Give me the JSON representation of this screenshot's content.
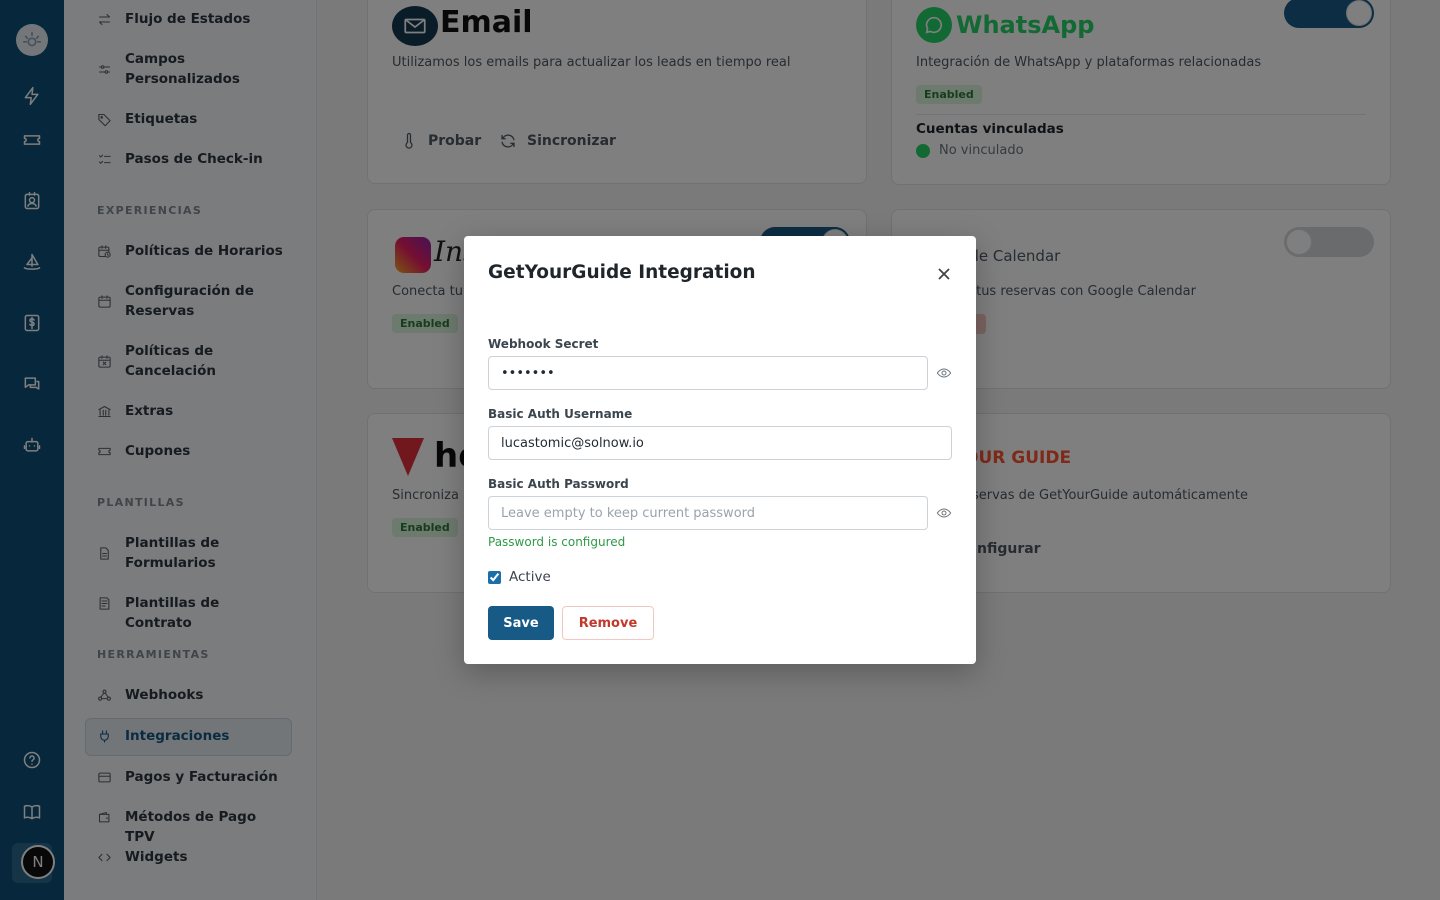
{
  "nav": {
    "items": [
      {
        "label": "Flujo de Estados",
        "icon": "arrows-swap-icon"
      },
      {
        "label": "Campos Personalizados",
        "icon": "sliders-icon"
      },
      {
        "label": "Etiquetas",
        "icon": "tag-icon"
      },
      {
        "label": "Pasos de Check-in",
        "icon": "list-check-icon"
      },
      {
        "label": "Políticas de Horarios",
        "icon": "calendar-clock-icon"
      },
      {
        "label": "Configuración de Reservas",
        "icon": "calendar-icon"
      },
      {
        "label": "Políticas de Cancelación",
        "icon": "calendar-x-icon"
      },
      {
        "label": "Extras",
        "icon": "bank-icon"
      },
      {
        "label": "Cupones",
        "icon": "ticket-icon"
      },
      {
        "label": "Plantillas de Formularios",
        "icon": "document-icon"
      },
      {
        "label": "Plantillas de Contrato",
        "icon": "contract-icon"
      },
      {
        "label": "Webhooks",
        "icon": "webhook-icon"
      },
      {
        "label": "Integraciones",
        "icon": "plug-icon"
      },
      {
        "label": "Pagos y Facturación",
        "icon": "credit-card-icon"
      },
      {
        "label": "Métodos de Pago TPV",
        "icon": "wallet-icon"
      },
      {
        "label": "Widgets",
        "icon": "code-icon"
      }
    ],
    "sections": {
      "experiencias": "EXPERIENCIAS",
      "plantillas": "PLANTILLAS",
      "herramientas": "HERRAMIENTAS"
    }
  },
  "rail": {
    "avatar_letter": "N"
  },
  "cards": {
    "email": {
      "name": "Email",
      "desc": "Utilizamos los emails para actualizar los leads en tiempo real",
      "test_label": "Probar",
      "sync_label": "Sincronizar"
    },
    "whatsapp": {
      "name": "WhatsApp",
      "desc": "Integración de WhatsApp y plataformas relacionadas",
      "badge": "Enabled",
      "linked_title": "Cuentas vinculadas",
      "linked_status": "No vinculado"
    },
    "instagram": {
      "name": "Ins",
      "desc": "Conecta tu",
      "badge": "Enabled"
    },
    "gcal": {
      "name": "ogle Calendar",
      "desc": "a tus reservas con Google Calendar"
    },
    "holded": {
      "name": "ho",
      "desc": "Sincroniza",
      "badge": "Enabled"
    },
    "gyg": {
      "name": "OUR GUIDE",
      "desc": "eservas de GetYourGuide automáticamente",
      "config_label": "nfigurar"
    }
  },
  "modal": {
    "title": "GetYourGuide Integration",
    "webhook_secret": {
      "label": "Webhook Secret",
      "value": "•••••••"
    },
    "username": {
      "label": "Basic Auth Username",
      "value": "lucastomic@solnow.io"
    },
    "password": {
      "label": "Basic Auth Password",
      "placeholder": "Leave empty to keep current password",
      "hint": "Password is configured"
    },
    "active_label": "Active",
    "save_label": "Save",
    "remove_label": "Remove"
  },
  "colors": {
    "rail": "#0f5178",
    "primary": "#185a86",
    "success": "#2e9a47",
    "danger": "#c0392b",
    "whatsapp": "#25d366",
    "gyg": "#ff5533"
  }
}
